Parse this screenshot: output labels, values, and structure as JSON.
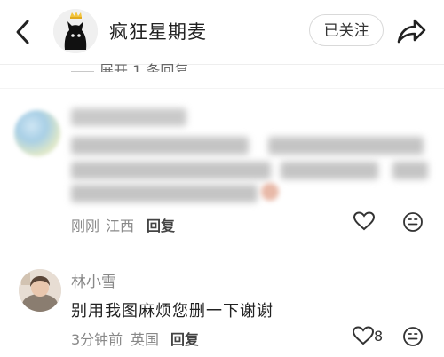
{
  "header": {
    "title": "疯狂星期麦",
    "follow_label": "已关注"
  },
  "expand": {
    "label": "展开 1 条回复"
  },
  "comments": [
    {
      "time": "刚刚",
      "location": "江西",
      "reply_label": "回复"
    },
    {
      "username": "林小雪",
      "text": "别用我图麻烦您删一下谢谢",
      "time": "3分钟前",
      "location": "英国",
      "reply_label": "回复",
      "likes": "8"
    }
  ],
  "icons": {
    "back": "back-arrow-icon",
    "share": "share-icon",
    "like": "heart-icon",
    "emoji": "emoji-icon"
  }
}
